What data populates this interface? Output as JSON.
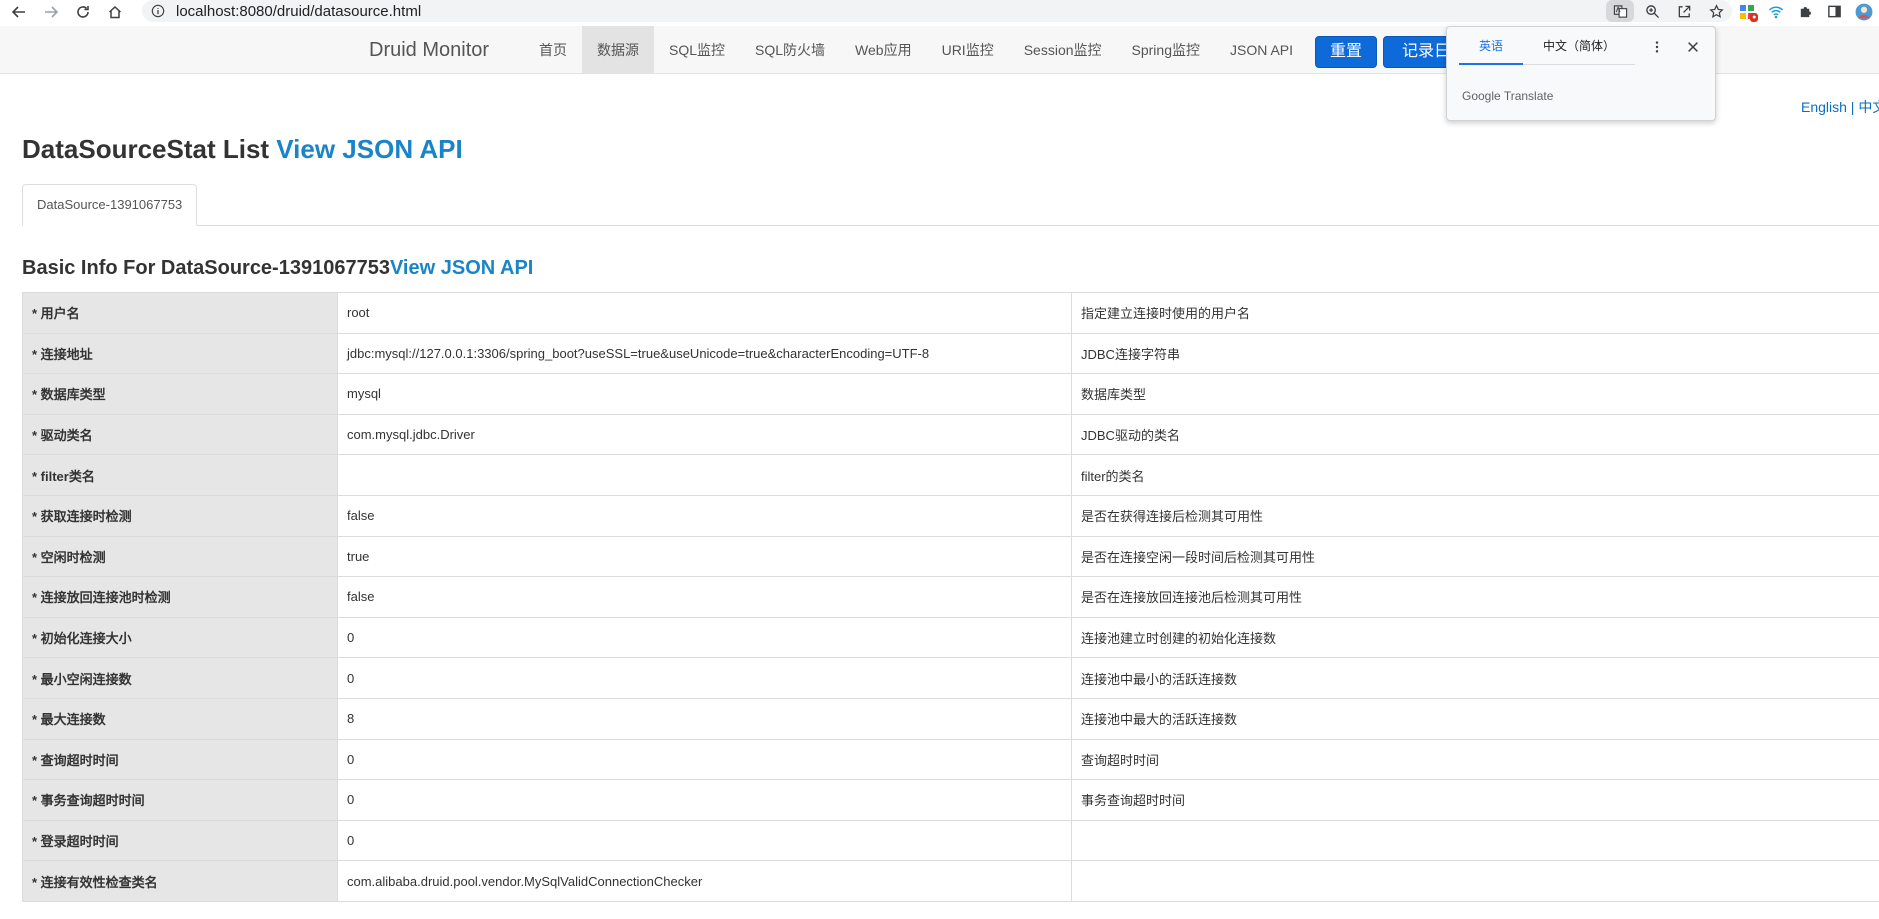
{
  "browser": {
    "url": "localhost:8080/druid/datasource.html"
  },
  "nav": {
    "brand": "Druid Monitor",
    "items": [
      {
        "label": "首页",
        "active": false
      },
      {
        "label": "数据源",
        "active": true
      },
      {
        "label": "SQL监控",
        "active": false
      },
      {
        "label": "SQL防火墙",
        "active": false
      },
      {
        "label": "Web应用",
        "active": false
      },
      {
        "label": "URI监控",
        "active": false
      },
      {
        "label": "Session监控",
        "active": false
      },
      {
        "label": "Spring监控",
        "active": false
      },
      {
        "label": "JSON API",
        "active": false
      }
    ],
    "reset_label": "重置",
    "log_label": "记录日志并重置"
  },
  "translate": {
    "tab_english": "英语",
    "tab_chinese": "中文（简体）",
    "brand": "Google Translate"
  },
  "lang_switch": "English | 中文",
  "page": {
    "title": "DataSourceStat List ",
    "title_link": "View JSON API",
    "datasource_tab": "DataSource-1391067753",
    "section_title": "Basic Info For DataSource-1391067753",
    "section_link": "View JSON API"
  },
  "rows": [
    {
      "label": "* 用户名",
      "value": "root",
      "desc": "指定建立连接时使用的用户名"
    },
    {
      "label": "* 连接地址",
      "value": "jdbc:mysql://127.0.0.1:3306/spring_boot?useSSL=true&useUnicode=true&characterEncoding=UTF-8",
      "desc": "JDBC连接字符串"
    },
    {
      "label": "* 数据库类型",
      "value": "mysql",
      "desc": "数据库类型"
    },
    {
      "label": "* 驱动类名",
      "value": "com.mysql.jdbc.Driver",
      "desc": "JDBC驱动的类名"
    },
    {
      "label": "* filter类名",
      "value": "",
      "desc": "filter的类名"
    },
    {
      "label": "* 获取连接时检测",
      "value": "false",
      "desc": "是否在获得连接后检测其可用性"
    },
    {
      "label": "* 空闲时检测",
      "value": "true",
      "desc": "是否在连接空闲一段时间后检测其可用性"
    },
    {
      "label": "* 连接放回连接池时检测",
      "value": "false",
      "desc": "是否在连接放回连接池后检测其可用性"
    },
    {
      "label": "* 初始化连接大小",
      "value": "0",
      "desc": "连接池建立时创建的初始化连接数"
    },
    {
      "label": "* 最小空闲连接数",
      "value": "0",
      "desc": "连接池中最小的活跃连接数"
    },
    {
      "label": "* 最大连接数",
      "value": "8",
      "desc": "连接池中最大的活跃连接数"
    },
    {
      "label": "* 查询超时时间",
      "value": "0",
      "desc": "查询超时时间"
    },
    {
      "label": "* 事务查询超时时间",
      "value": "0",
      "desc": "事务查询超时时间"
    },
    {
      "label": "* 登录超时时间",
      "value": "0",
      "desc": ""
    },
    {
      "label": "* 连接有效性检查类名",
      "value": "com.alibaba.druid.pool.vendor.MySqlValidConnectionChecker",
      "desc": ""
    }
  ]
}
